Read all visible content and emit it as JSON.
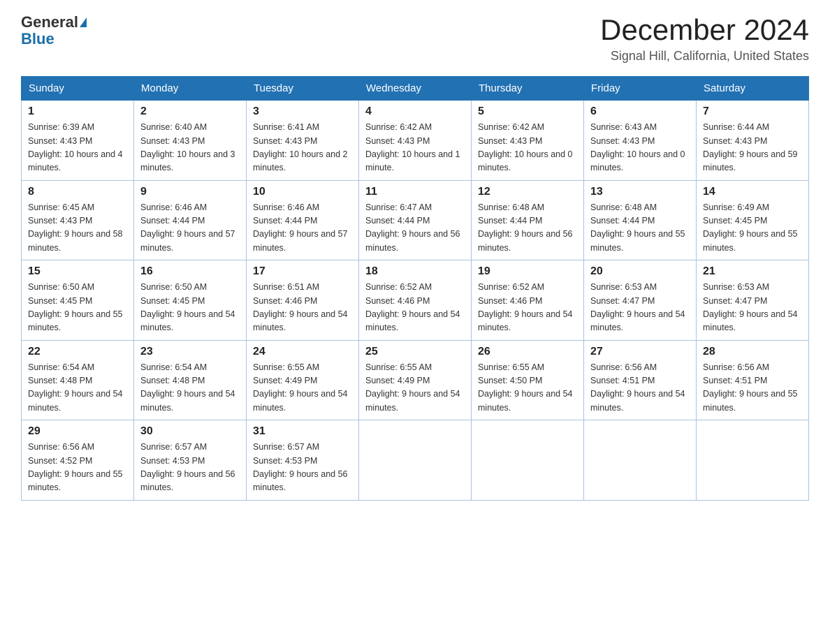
{
  "header": {
    "logo_general": "General",
    "logo_blue": "Blue",
    "month_title": "December 2024",
    "location": "Signal Hill, California, United States"
  },
  "days_of_week": [
    "Sunday",
    "Monday",
    "Tuesday",
    "Wednesday",
    "Thursday",
    "Friday",
    "Saturday"
  ],
  "weeks": [
    [
      {
        "day": "1",
        "sunrise": "6:39 AM",
        "sunset": "4:43 PM",
        "daylight": "10 hours and 4 minutes."
      },
      {
        "day": "2",
        "sunrise": "6:40 AM",
        "sunset": "4:43 PM",
        "daylight": "10 hours and 3 minutes."
      },
      {
        "day": "3",
        "sunrise": "6:41 AM",
        "sunset": "4:43 PM",
        "daylight": "10 hours and 2 minutes."
      },
      {
        "day": "4",
        "sunrise": "6:42 AM",
        "sunset": "4:43 PM",
        "daylight": "10 hours and 1 minute."
      },
      {
        "day": "5",
        "sunrise": "6:42 AM",
        "sunset": "4:43 PM",
        "daylight": "10 hours and 0 minutes."
      },
      {
        "day": "6",
        "sunrise": "6:43 AM",
        "sunset": "4:43 PM",
        "daylight": "10 hours and 0 minutes."
      },
      {
        "day": "7",
        "sunrise": "6:44 AM",
        "sunset": "4:43 PM",
        "daylight": "9 hours and 59 minutes."
      }
    ],
    [
      {
        "day": "8",
        "sunrise": "6:45 AM",
        "sunset": "4:43 PM",
        "daylight": "9 hours and 58 minutes."
      },
      {
        "day": "9",
        "sunrise": "6:46 AM",
        "sunset": "4:44 PM",
        "daylight": "9 hours and 57 minutes."
      },
      {
        "day": "10",
        "sunrise": "6:46 AM",
        "sunset": "4:44 PM",
        "daylight": "9 hours and 57 minutes."
      },
      {
        "day": "11",
        "sunrise": "6:47 AM",
        "sunset": "4:44 PM",
        "daylight": "9 hours and 56 minutes."
      },
      {
        "day": "12",
        "sunrise": "6:48 AM",
        "sunset": "4:44 PM",
        "daylight": "9 hours and 56 minutes."
      },
      {
        "day": "13",
        "sunrise": "6:48 AM",
        "sunset": "4:44 PM",
        "daylight": "9 hours and 55 minutes."
      },
      {
        "day": "14",
        "sunrise": "6:49 AM",
        "sunset": "4:45 PM",
        "daylight": "9 hours and 55 minutes."
      }
    ],
    [
      {
        "day": "15",
        "sunrise": "6:50 AM",
        "sunset": "4:45 PM",
        "daylight": "9 hours and 55 minutes."
      },
      {
        "day": "16",
        "sunrise": "6:50 AM",
        "sunset": "4:45 PM",
        "daylight": "9 hours and 54 minutes."
      },
      {
        "day": "17",
        "sunrise": "6:51 AM",
        "sunset": "4:46 PM",
        "daylight": "9 hours and 54 minutes."
      },
      {
        "day": "18",
        "sunrise": "6:52 AM",
        "sunset": "4:46 PM",
        "daylight": "9 hours and 54 minutes."
      },
      {
        "day": "19",
        "sunrise": "6:52 AM",
        "sunset": "4:46 PM",
        "daylight": "9 hours and 54 minutes."
      },
      {
        "day": "20",
        "sunrise": "6:53 AM",
        "sunset": "4:47 PM",
        "daylight": "9 hours and 54 minutes."
      },
      {
        "day": "21",
        "sunrise": "6:53 AM",
        "sunset": "4:47 PM",
        "daylight": "9 hours and 54 minutes."
      }
    ],
    [
      {
        "day": "22",
        "sunrise": "6:54 AM",
        "sunset": "4:48 PM",
        "daylight": "9 hours and 54 minutes."
      },
      {
        "day": "23",
        "sunrise": "6:54 AM",
        "sunset": "4:48 PM",
        "daylight": "9 hours and 54 minutes."
      },
      {
        "day": "24",
        "sunrise": "6:55 AM",
        "sunset": "4:49 PM",
        "daylight": "9 hours and 54 minutes."
      },
      {
        "day": "25",
        "sunrise": "6:55 AM",
        "sunset": "4:49 PM",
        "daylight": "9 hours and 54 minutes."
      },
      {
        "day": "26",
        "sunrise": "6:55 AM",
        "sunset": "4:50 PM",
        "daylight": "9 hours and 54 minutes."
      },
      {
        "day": "27",
        "sunrise": "6:56 AM",
        "sunset": "4:51 PM",
        "daylight": "9 hours and 54 minutes."
      },
      {
        "day": "28",
        "sunrise": "6:56 AM",
        "sunset": "4:51 PM",
        "daylight": "9 hours and 55 minutes."
      }
    ],
    [
      {
        "day": "29",
        "sunrise": "6:56 AM",
        "sunset": "4:52 PM",
        "daylight": "9 hours and 55 minutes."
      },
      {
        "day": "30",
        "sunrise": "6:57 AM",
        "sunset": "4:53 PM",
        "daylight": "9 hours and 56 minutes."
      },
      {
        "day": "31",
        "sunrise": "6:57 AM",
        "sunset": "4:53 PM",
        "daylight": "9 hours and 56 minutes."
      },
      null,
      null,
      null,
      null
    ]
  ]
}
